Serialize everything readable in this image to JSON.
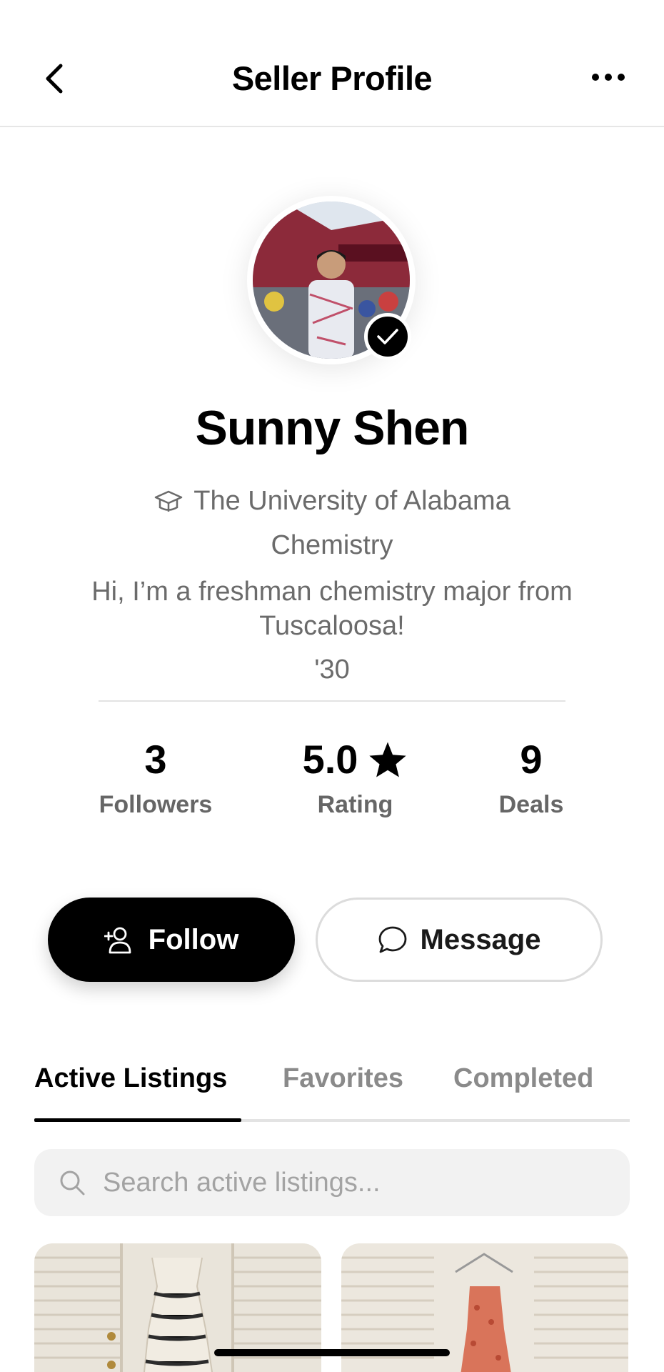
{
  "header": {
    "title": "Seller Profile",
    "back_icon": "chevron-left-icon",
    "more_icon": "ellipsis-icon"
  },
  "profile": {
    "name": "Sunny Shen",
    "school": "The University of Alabama",
    "school_icon": "graduation-cap-icon",
    "major": "Chemistry",
    "bio": "Hi, I’m a freshman chemistry major from Tuscaloosa!",
    "grad_year": "'30",
    "verified": true
  },
  "stats": {
    "followers": {
      "value": "3",
      "label": "Followers"
    },
    "rating": {
      "value": "5.0",
      "label": "Rating",
      "icon": "star-icon"
    },
    "deals": {
      "value": "9",
      "label": "Deals"
    }
  },
  "actions": {
    "follow_label": "Follow",
    "message_label": "Message"
  },
  "tabs": [
    {
      "label": "Active Listings",
      "active": true
    },
    {
      "label": "Favorites",
      "active": false
    },
    {
      "label": "Completed",
      "active": false
    }
  ],
  "search": {
    "placeholder": "Search active listings..."
  },
  "colors": {
    "primary": "#000000",
    "muted_text": "#6b6b6b",
    "search_bg": "#f2f2f2"
  }
}
